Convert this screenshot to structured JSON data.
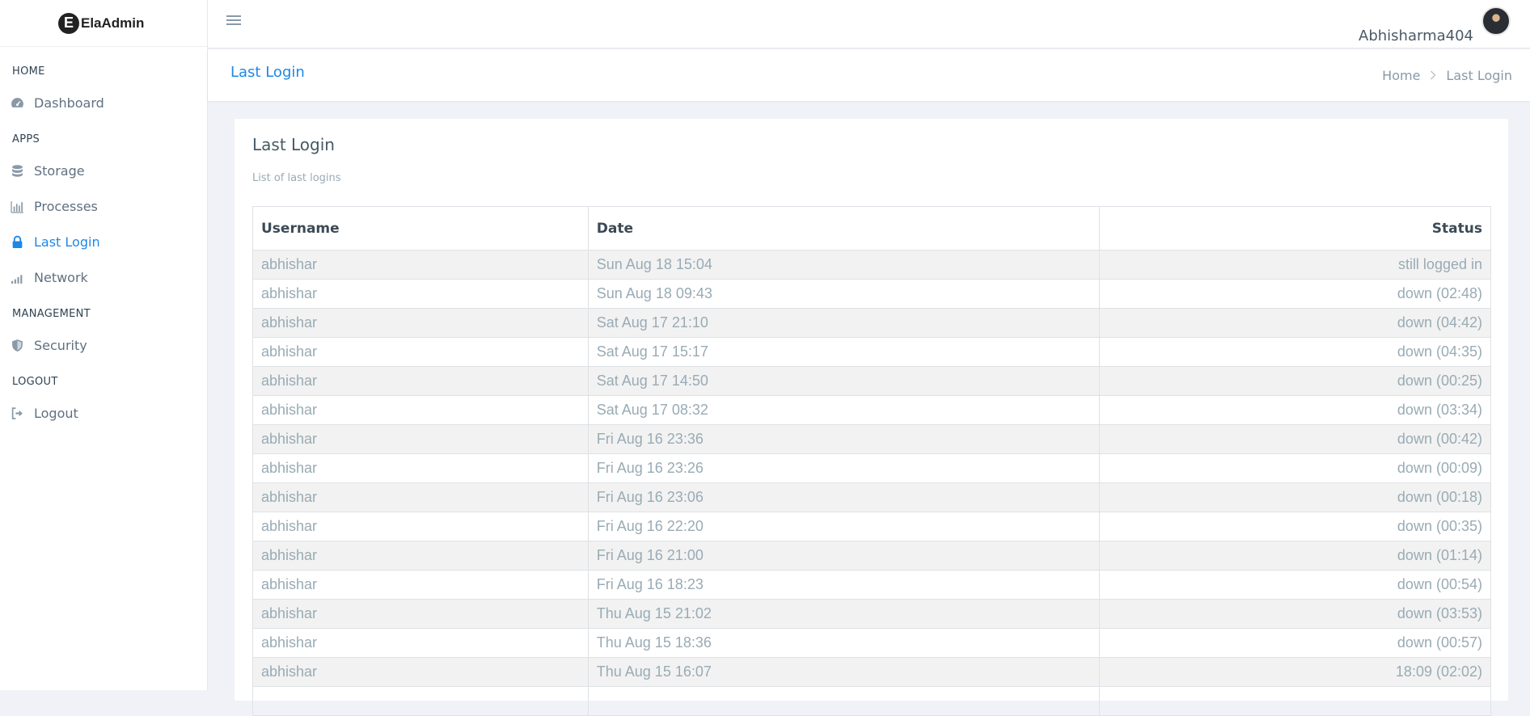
{
  "brand": {
    "logo_letter": "E",
    "name": "ElaAdmin"
  },
  "sidebar": {
    "sections": [
      {
        "label": "HOME",
        "items": [
          {
            "label": "Dashboard",
            "icon": "dashboard-icon"
          }
        ]
      },
      {
        "label": "APPS",
        "items": [
          {
            "label": "Storage",
            "icon": "database-icon"
          },
          {
            "label": "Processes",
            "icon": "bar-chart-icon"
          },
          {
            "label": "Last Login",
            "icon": "lock-icon",
            "active": true
          },
          {
            "label": "Network",
            "icon": "signal-icon"
          }
        ]
      },
      {
        "label": "MANAGEMENT",
        "items": [
          {
            "label": "Security",
            "icon": "shield-icon"
          }
        ]
      },
      {
        "label": "LOGOUT",
        "items": [
          {
            "label": "Logout",
            "icon": "sign-out-icon"
          }
        ]
      }
    ]
  },
  "header": {
    "user_name": "Abhisharma404"
  },
  "pagebar": {
    "title": "Last Login",
    "breadcrumb": {
      "home": "Home",
      "current": "Last Login"
    }
  },
  "card": {
    "title": "Last Login",
    "subtitle": "List of last logins",
    "columns": [
      "Username",
      "Date",
      "Status"
    ],
    "rows": [
      [
        "abhishar",
        "Sun Aug 18 15:04",
        "still logged in"
      ],
      [
        "abhishar",
        "Sun Aug 18 09:43",
        "down (02:48)"
      ],
      [
        "abhishar",
        "Sat Aug 17 21:10",
        "down (04:42)"
      ],
      [
        "abhishar",
        "Sat Aug 17 15:17",
        "down (04:35)"
      ],
      [
        "abhishar",
        "Sat Aug 17 14:50",
        "down (00:25)"
      ],
      [
        "abhishar",
        "Sat Aug 17 08:32",
        "down (03:34)"
      ],
      [
        "abhishar",
        "Fri Aug 16 23:36",
        "down (00:42)"
      ],
      [
        "abhishar",
        "Fri Aug 16 23:26",
        "down (00:09)"
      ],
      [
        "abhishar",
        "Fri Aug 16 23:06",
        "down (00:18)"
      ],
      [
        "abhishar",
        "Fri Aug 16 22:20",
        "down (00:35)"
      ],
      [
        "abhishar",
        "Fri Aug 16 21:00",
        "down (01:14)"
      ],
      [
        "abhishar",
        "Fri Aug 16 18:23",
        "down (00:54)"
      ],
      [
        "abhishar",
        "Thu Aug 15 21:02",
        "down (03:53)"
      ],
      [
        "abhishar",
        "Thu Aug 15 18:36",
        "down (00:57)"
      ],
      [
        "abhishar",
        "Thu Aug 15 16:07",
        "18:09 (02:02)"
      ],
      [
        "",
        "",
        ""
      ]
    ]
  },
  "colors": {
    "accent": "#1e88e5",
    "muted_text": "#99abb4",
    "stripe": "#f2f2f2"
  }
}
